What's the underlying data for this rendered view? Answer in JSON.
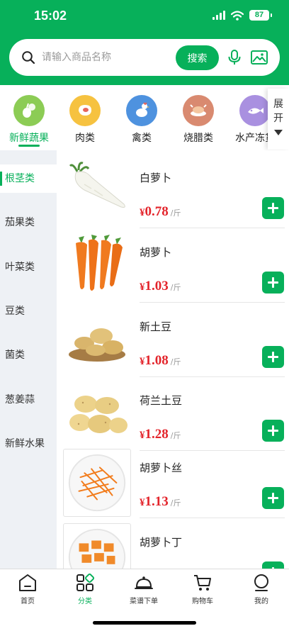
{
  "status_bar": {
    "time": "15:02",
    "battery": "87"
  },
  "search": {
    "placeholder": "请输入商品名称",
    "button_label": "搜索"
  },
  "categories": [
    {
      "label": "新鲜蔬果",
      "icon": "vegetable-icon",
      "color": "#8ccc55",
      "active": true
    },
    {
      "label": "肉类",
      "icon": "meat-icon",
      "color": "#f6c240",
      "active": false
    },
    {
      "label": "禽类",
      "icon": "chicken-icon",
      "color": "#4e92df",
      "active": false
    },
    {
      "label": "烧腊类",
      "icon": "roast-icon",
      "color": "#d98a70",
      "active": false
    },
    {
      "label": "水产冻货",
      "icon": "seafood-icon",
      "color": "#a990e0",
      "active": false
    }
  ],
  "expand": {
    "label_1": "展",
    "label_2": "开"
  },
  "sidebar": {
    "items": [
      {
        "label": "根茎类",
        "active": true
      },
      {
        "label": "茄果类",
        "active": false
      },
      {
        "label": "叶菜类",
        "active": false
      },
      {
        "label": "豆类",
        "active": false
      },
      {
        "label": "菌类",
        "active": false
      },
      {
        "label": "葱姜蒜",
        "active": false
      },
      {
        "label": "新鲜水果",
        "active": false
      }
    ]
  },
  "products": [
    {
      "name": "白萝卜",
      "yen": "¥",
      "price": "0.78",
      "unit": "/斤",
      "image": "white-radish-image"
    },
    {
      "name": "胡萝卜",
      "yen": "¥",
      "price": "1.03",
      "unit": "/斤",
      "image": "carrot-image"
    },
    {
      "name": "新土豆",
      "yen": "¥",
      "price": "1.08",
      "unit": "/斤",
      "image": "new-potato-image"
    },
    {
      "name": "荷兰土豆",
      "yen": "¥",
      "price": "1.28",
      "unit": "/斤",
      "image": "dutch-potato-image"
    },
    {
      "name": "胡萝卜丝",
      "yen": "¥",
      "price": "1.13",
      "unit": "/斤",
      "image": "shredded-carrot-image"
    },
    {
      "name": "胡萝卜丁",
      "yen": "",
      "price": "",
      "unit": "",
      "image": "diced-carrot-image"
    }
  ],
  "tab_bar": {
    "tabs": [
      {
        "label": "首页",
        "icon": "home-icon",
        "active": false
      },
      {
        "label": "分类",
        "icon": "category-icon",
        "active": true
      },
      {
        "label": "菜谱下单",
        "icon": "recipe-order-icon",
        "active": false
      },
      {
        "label": "购物车",
        "icon": "cart-icon",
        "active": false
      },
      {
        "label": "我的",
        "icon": "profile-icon",
        "active": false
      }
    ]
  },
  "colors": {
    "brand_green": "#07b05a",
    "price_red": "#e3242b",
    "sidebar_bg": "#eef1f5"
  }
}
